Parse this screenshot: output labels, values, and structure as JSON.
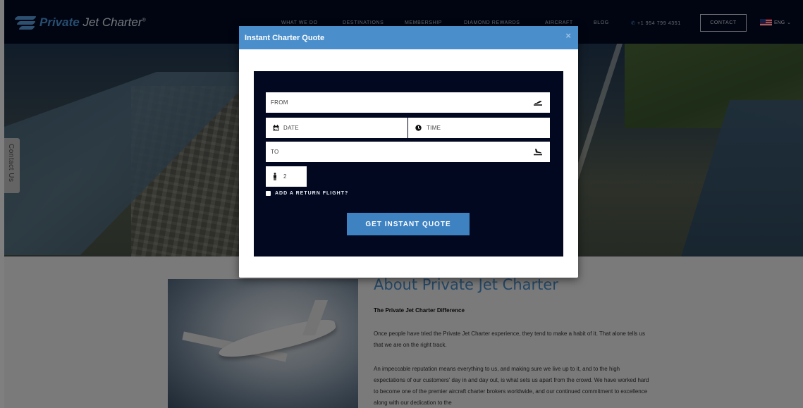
{
  "brand": {
    "name_part1": "Private",
    "name_part2": "Jet Charter",
    "mark": "®"
  },
  "nav": {
    "items": [
      "WHAT WE DO",
      "DESTINATIONS",
      "MEMBERSHIP",
      "DIAMOND REWARDS",
      "AIRCRAFT",
      "BLOG"
    ],
    "phone": "+1 954 799 4351",
    "contact": "CONTACT",
    "language": "ENG"
  },
  "contact_tab": "Contact Us",
  "modal": {
    "title": "Instant Charter Quote",
    "close": "×",
    "from_placeholder": "FROM",
    "date_placeholder": "DATE",
    "time_placeholder": "TIME",
    "to_placeholder": "TO",
    "passengers": "2",
    "return_label": "ADD A RETURN FLIGHT?",
    "submit": "GET INSTANT QUOTE"
  },
  "about": {
    "title": "About Private Jet Charter",
    "subtitle": "The Private Jet Charter Difference",
    "p1": "Once people have tried the Private Jet Charter experience, they tend to make a habit of it. That alone tells us that we are on the right track.",
    "p2": "An impeccable reputation means everything to us, and making sure we live up to it, and to the high expectations of our customers' day in and day out, is what sets us apart from the crowd. We have worked hard to become one of the premier aircraft charter brokers worldwide, and our continued commitment to excellence along with our dedication to the"
  },
  "colors": {
    "accent": "#4a8fcc",
    "navy": "#020820",
    "button": "#3f82c2"
  },
  "icons": [
    "takeoff-icon",
    "calendar-icon",
    "clock-icon",
    "landing-icon",
    "person-icon",
    "phone-icon",
    "flag-icon",
    "chevron-down-icon",
    "close-icon"
  ]
}
